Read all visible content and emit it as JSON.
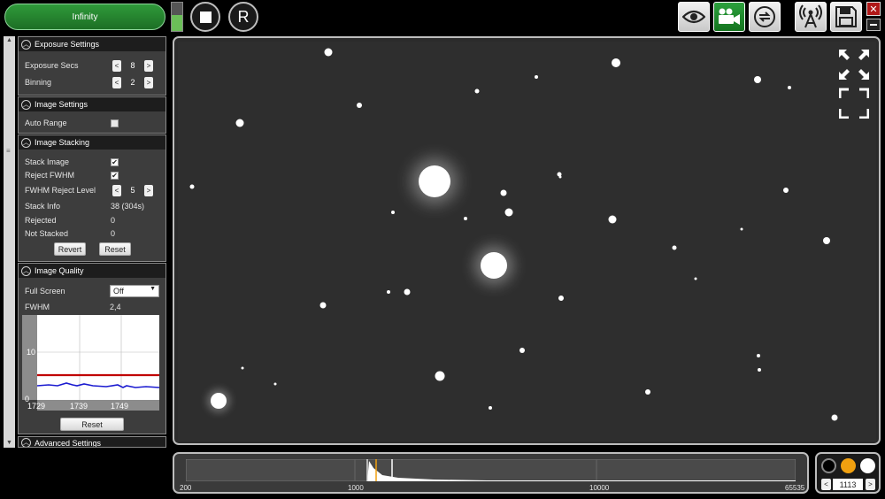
{
  "toolbar": {
    "infinity_label": "Infinity",
    "level_fraction": 0.55,
    "r_label": "R",
    "close_glyph": "✕"
  },
  "icons": {
    "stop": "stop-icon",
    "eye": "eye-icon",
    "video": "video-camera-icon",
    "cycle": "refresh-icon",
    "antenna": "antenna-icon",
    "save": "save-icon"
  },
  "colors": {
    "accent_green": "#1f8a2c",
    "highlight_orange": "#f0a010"
  },
  "exposure": {
    "title": "Exposure Settings",
    "exposure_secs_label": "Exposure Secs",
    "exposure_secs_value": "8",
    "binning_label": "Binning",
    "binning_value": "2",
    "dec": "<",
    "inc": ">"
  },
  "image_settings": {
    "title": "Image Settings",
    "auto_range_label": "Auto Range"
  },
  "stacking": {
    "title": "Image Stacking",
    "stack_image_label": "Stack Image",
    "stack_image_checked": "✔",
    "reject_fwhm_label": "Reject FWHM",
    "reject_fwhm_checked": "✔",
    "fwhm_reject_level_label": "FWHM Reject Level",
    "fwhm_reject_level_value": "5",
    "stack_info_label": "Stack Info",
    "stack_info_value": "38 (304s)",
    "rejected_label": "Rejected",
    "rejected_value": "0",
    "not_stacked_label": "Not Stacked",
    "not_stacked_value": "0",
    "revert_label": "Revert",
    "reset_label": "Reset"
  },
  "image_quality": {
    "title": "Image Quality",
    "full_screen_label": "Full Screen",
    "full_screen_value": "Off",
    "fwhm_label": "FWHM",
    "fwhm_value": "2,4",
    "chart_y_top": "10",
    "chart_y_bottom": "0",
    "chart_x_labels": [
      "1729",
      "1739",
      "1749"
    ],
    "reset_label": "Reset"
  },
  "advanced": {
    "title": "Advanced Settings"
  },
  "histogram": {
    "labels": [
      "200",
      "1000",
      "10000",
      "65535"
    ]
  },
  "stretch": {
    "value": "1113",
    "dec": "<",
    "inc": ">"
  }
}
